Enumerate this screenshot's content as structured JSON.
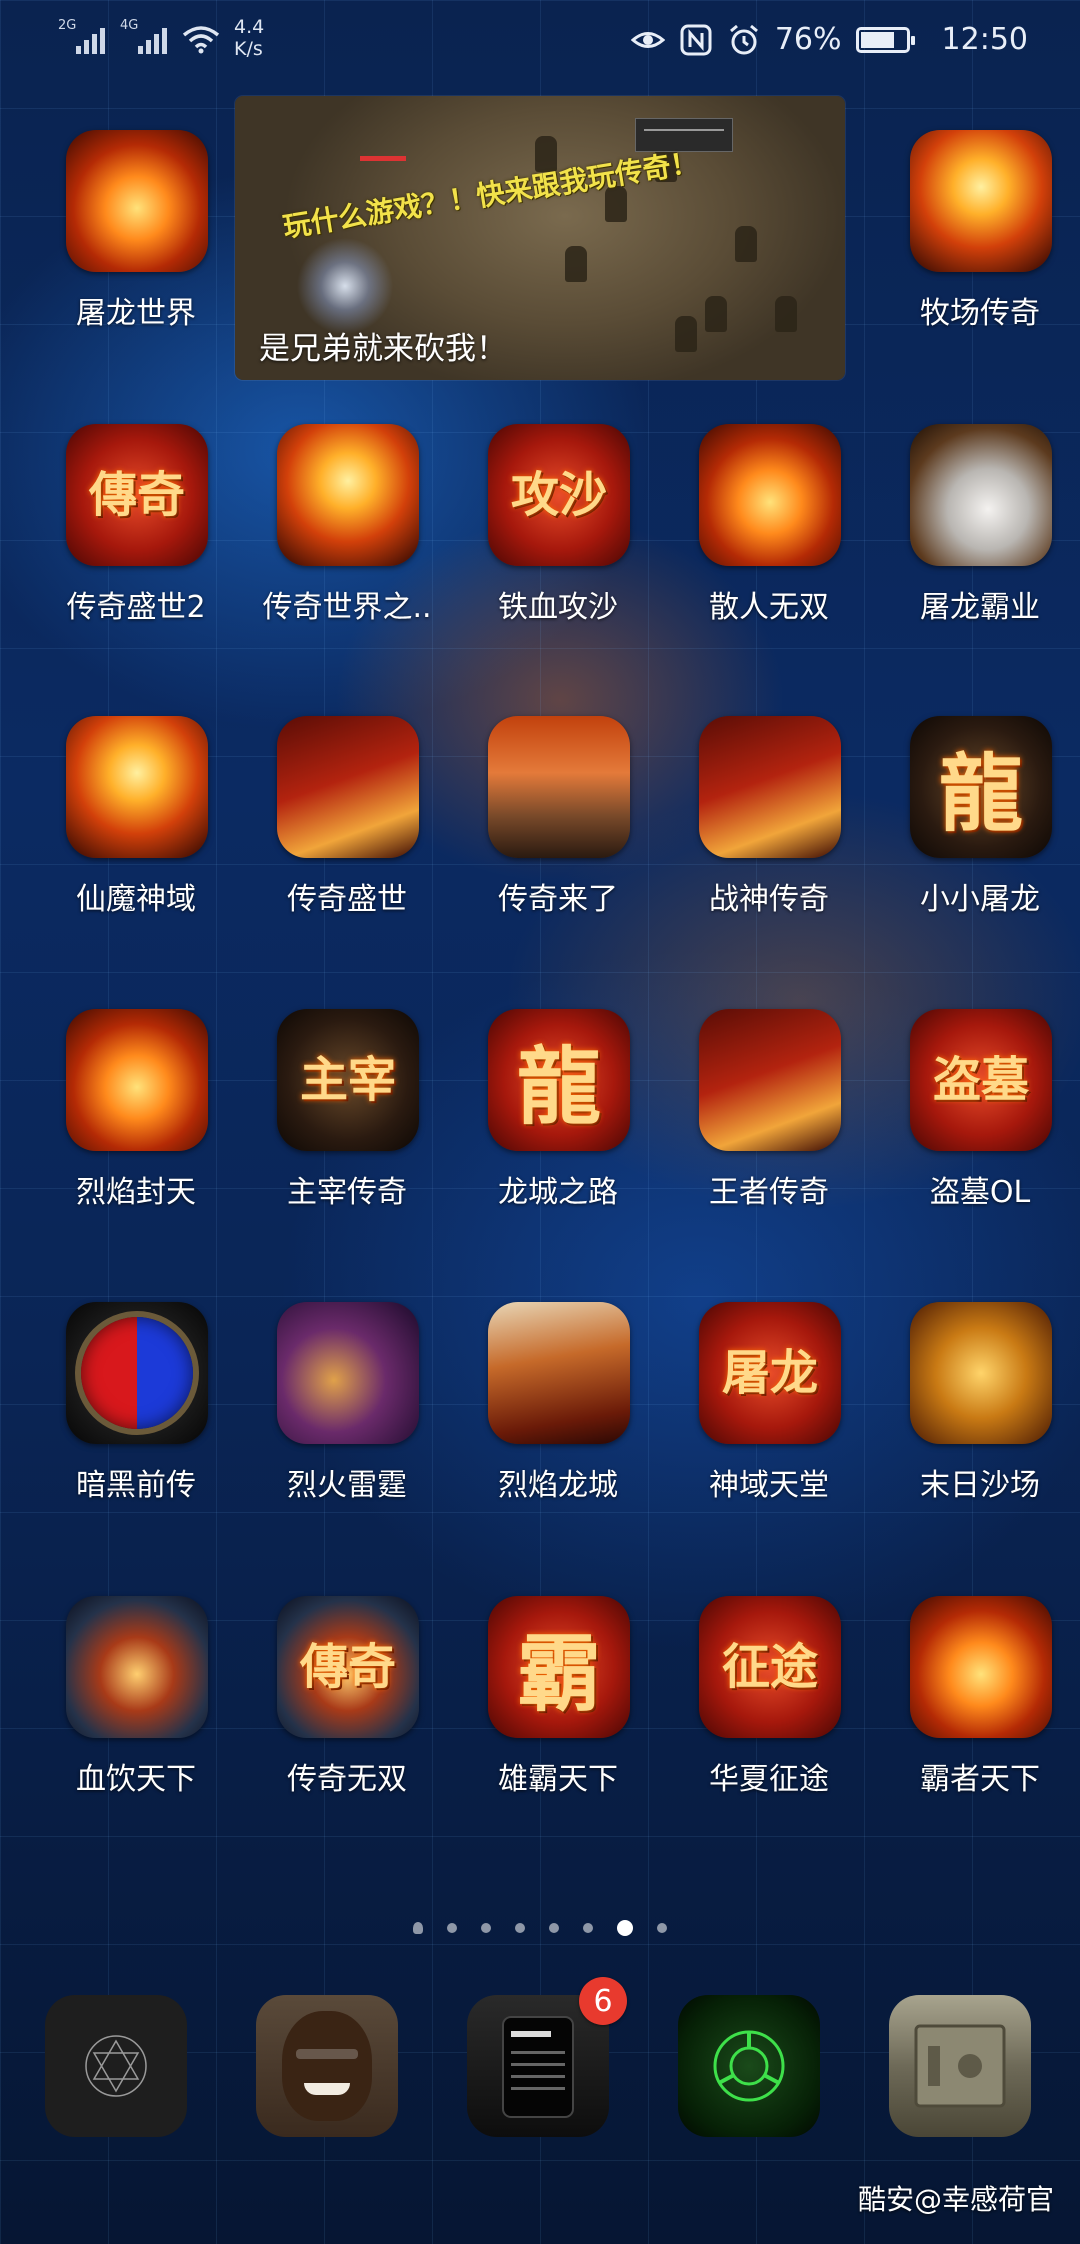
{
  "status_bar": {
    "signal1_tag": "2G",
    "signal2_tag": "4G",
    "speed_value": "4.4",
    "speed_unit": "K/s",
    "battery_percent": "76%",
    "battery_level": 0.76,
    "time": "12:50",
    "icons": [
      "eye-icon",
      "nfc-icon",
      "alarm-icon"
    ]
  },
  "widget": {
    "slogan": "玩什么游戏？！快来跟我玩传奇！",
    "caption": "是兄弟就来砍我！"
  },
  "apps": [
    {
      "label": "屠龙世界",
      "glyph": "",
      "style": "s-fire"
    },
    {
      "label": "牧场传奇",
      "glyph": "",
      "style": "s-phoenix"
    },
    {
      "label": "传奇盛世2",
      "glyph": "傳奇",
      "style": "s-red"
    },
    {
      "label": "传奇世界之..",
      "glyph": "",
      "style": "s-phoenix"
    },
    {
      "label": "铁血攻沙",
      "glyph": "攻沙",
      "style": "s-red"
    },
    {
      "label": "散人无双",
      "glyph": "",
      "style": "s-fire"
    },
    {
      "label": "屠龙霸业",
      "glyph": "",
      "style": "s-white"
    },
    {
      "label": "仙魔神域",
      "glyph": "",
      "style": "s-phoenix"
    },
    {
      "label": "传奇盛世",
      "glyph": "",
      "style": "s-redgold"
    },
    {
      "label": "传奇来了",
      "glyph": "",
      "style": "s-face"
    },
    {
      "label": "战神传奇",
      "glyph": "",
      "style": "s-redgold"
    },
    {
      "label": "小小屠龙",
      "glyph": "龍",
      "style": "s-dark"
    },
    {
      "label": "烈焰封天",
      "glyph": "",
      "style": "s-fire"
    },
    {
      "label": "主宰传奇",
      "glyph": "主宰",
      "style": "s-dark"
    },
    {
      "label": "龙城之路",
      "glyph": "龍",
      "style": "s-red"
    },
    {
      "label": "王者传奇",
      "glyph": "",
      "style": "s-redgold"
    },
    {
      "label": "盗墓OL",
      "glyph": "盗墓",
      "style": "s-red"
    },
    {
      "label": "暗黑前传",
      "glyph": "",
      "style": "s-orb"
    },
    {
      "label": "烈火雷霆",
      "glyph": "",
      "style": "s-purple"
    },
    {
      "label": "烈焰龙城",
      "glyph": "",
      "style": "s-chain"
    },
    {
      "label": "神域天堂",
      "glyph": "屠龙",
      "style": "s-red"
    },
    {
      "label": "末日沙场",
      "glyph": "",
      "style": "s-gold"
    },
    {
      "label": "血饮天下",
      "glyph": "",
      "style": "s-blue"
    },
    {
      "label": "传奇无双",
      "glyph": "傳奇",
      "style": "s-blue"
    },
    {
      "label": "雄霸天下",
      "glyph": "霸",
      "style": "s-red"
    },
    {
      "label": "华夏征途",
      "glyph": "征途",
      "style": "s-red"
    },
    {
      "label": "霸者天下",
      "glyph": "",
      "style": "s-fire"
    }
  ],
  "page_indicator": {
    "count": 8,
    "active_index": 6
  },
  "dock": [
    {
      "name": "dock-app-1"
    },
    {
      "name": "dock-app-2"
    },
    {
      "name": "dock-app-3",
      "badge": "6"
    },
    {
      "name": "dock-app-4"
    },
    {
      "name": "dock-app-5"
    }
  ],
  "watermark": "酷安@幸感荷官"
}
